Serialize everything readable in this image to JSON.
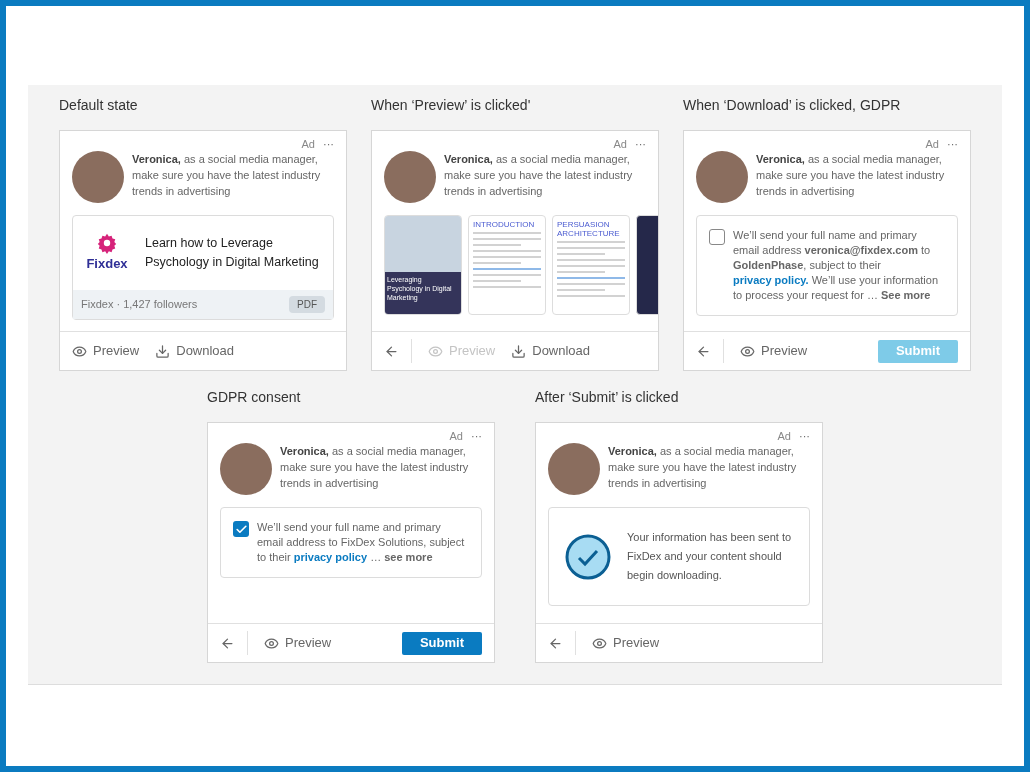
{
  "rows": [
    {
      "panels": [
        {
          "title": "Default state",
          "card": {
            "ad": "Ad",
            "menu": "···",
            "message": "**Veronica,** as a social media manager, make sure you have the latest industry trends in advertising",
            "body": {
              "kind": "document",
              "logo": "Fixdex",
              "title": "Learn how to Leverage Psychology in Digital Marketing",
              "meta": "Fixdex · 1,427 followers",
              "badge": "PDF"
            },
            "footer": [
              {
                "kind": "preview",
                "label": "Preview",
                "disabled": false
              },
              {
                "kind": "download",
                "label": "Download",
                "disabled": false
              }
            ]
          }
        },
        {
          "title": "When ‘Preview’ is clicked'",
          "card": {
            "ad": "Ad",
            "menu": "···",
            "message": "**Veronica,** as a social media manager, make sure you have the latest industry trends in advertising",
            "body": {
              "kind": "preview",
              "pages": [
                {
                  "kind": "cover",
                  "title": "Leveraging Psychology in Digital Marketing"
                },
                {
                  "kind": "text",
                  "heading": "INTRODUCTION"
                },
                {
                  "kind": "text",
                  "heading": "PERSUASION ARCHITECTURE"
                },
                {
                  "kind": "dark"
                }
              ]
            },
            "footer": [
              {
                "kind": "back",
                "disabled": false
              },
              {
                "kind": "preview",
                "label": "Preview",
                "disabled": true
              },
              {
                "kind": "download",
                "label": "Download",
                "disabled": false
              }
            ]
          }
        },
        {
          "title": "When ‘Download’ is clicked, GDPR",
          "card": {
            "ad": "Ad",
            "menu": "···",
            "message": "**Veronica,** as a social media manager, make sure you have the latest industry trends in advertising",
            "body": {
              "kind": "consent",
              "checked": false,
              "text": "We’ll send your full name and primary email address **veronica@fixdex.com** to **GoldenPhase**, subject to their",
              "link": "privacy policy.",
              "after": "We’ll use your information to process your request for  … **See more**"
            },
            "footer": [
              {
                "kind": "back",
                "disabled": false
              },
              {
                "kind": "preview",
                "label": "Preview",
                "disabled": false
              },
              {
                "kind": "submit",
                "label": "Submit",
                "disabled": true
              }
            ]
          }
        }
      ]
    },
    {
      "panels": [
        {
          "title": "GDPR consent",
          "card": {
            "ad": "Ad",
            "menu": "···",
            "message": "**Veronica,** as a social media manager, make sure you have the latest industry trends in advertising",
            "body": {
              "kind": "consent",
              "checked": true,
              "text": "We’ll send your full name and primary email address to FixDex Solutions, subject to their",
              "link": "privacy policy",
              "after": "… **see more**"
            },
            "footer": [
              {
                "kind": "back",
                "disabled": false
              },
              {
                "kind": "preview",
                "label": "Preview",
                "disabled": false
              },
              {
                "kind": "submit",
                "label": "Submit",
                "disabled": false
              }
            ]
          }
        },
        {
          "title": "After ‘Submit’ is clicked",
          "card": {
            "ad": "Ad",
            "menu": "···",
            "message": "**Veronica,** as a social media manager, make sure you have the latest industry trends in advertising",
            "body": {
              "kind": "success",
              "text": "Your information has been sent to FixDex and your content should begin downloading."
            },
            "footer": [
              {
                "kind": "back",
                "disabled": false
              },
              {
                "kind": "preview",
                "label": "Preview",
                "disabled": false
              }
            ]
          }
        }
      ]
    }
  ]
}
